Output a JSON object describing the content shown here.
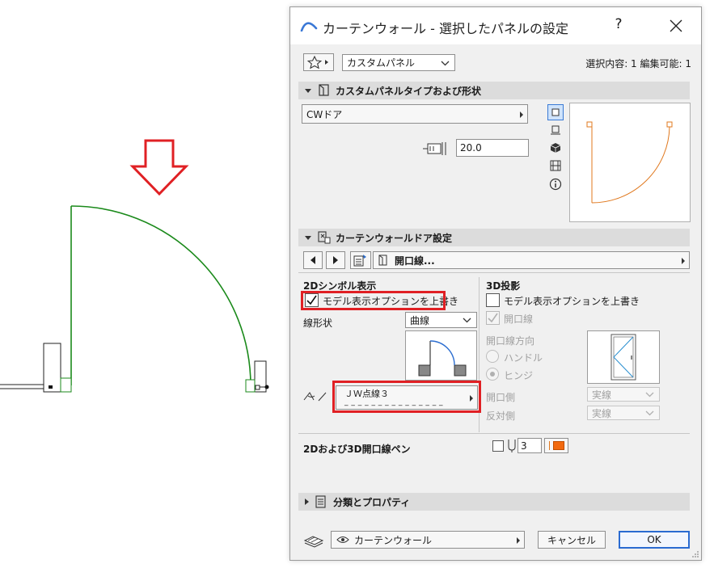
{
  "dialog": {
    "title": "カーテンウォール - 選択したパネルの設定",
    "help_label": "?",
    "favorite_selector": "カスタムパネル",
    "selection_info": "選択内容: 1 編集可能: 1"
  },
  "panel_type_section": {
    "header": "カスタムパネルタイプおよび形状",
    "type_value": "CWドア",
    "thickness_value": "20.0"
  },
  "door_section": {
    "header": "カーテンウォールドア設定",
    "page_label": "開口線...",
    "symbol_2d": {
      "heading": "2Dシンボル表示",
      "override_label": "モデル表示オプションを上書き",
      "override_checked": true,
      "line_shape_label": "線形状",
      "line_shape_value": "曲線",
      "line_type_value": "ＪＷ点線３",
      "line_type_dashes": "_ _ _ _ _ _ _ _ _ _ _ _ _ _ _"
    },
    "projection_3d": {
      "heading": "3D投影",
      "override_label": "モデル表示オプションを上書き",
      "override_checked": false,
      "opening_line_label": "開口線",
      "direction_label": "開口線方向",
      "handle_label": "ハンドル",
      "hinge_label": "ヒンジ",
      "hinge_selected": true,
      "opening_side_label": "開口側",
      "opening_side_value": "実線",
      "opposite_side_label": "反対側",
      "opposite_side_value": "実線"
    },
    "pen_label": "2Dおよび3D開口線ペン",
    "pen_value": "3",
    "pen_color": "#f26a10"
  },
  "classification_section": {
    "header": "分類とプロパティ"
  },
  "footer": {
    "layer_value": "カーテンウォール",
    "cancel_label": "キャンセル",
    "ok_label": "OK"
  },
  "colors": {
    "door_arc": "#1b8a1b",
    "preview_arc": "#e0781e",
    "highlight": "#e02024",
    "ok_border": "#2a6bd1"
  }
}
